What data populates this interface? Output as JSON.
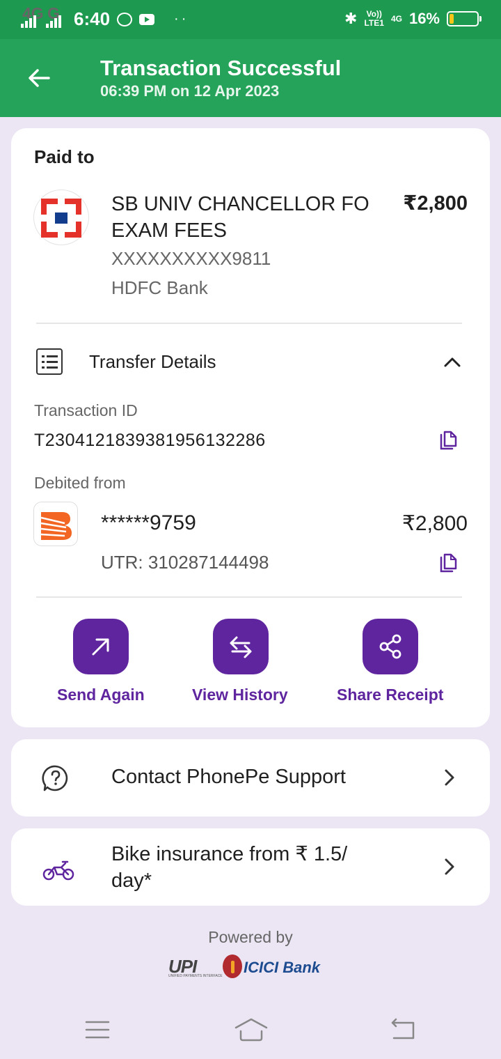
{
  "status_bar": {
    "net1": "4G",
    "net2": "G",
    "time": "6:40",
    "volte_line1": "Vo))",
    "volte_line2": "LTE1",
    "net3": "4G",
    "battery_text": "16%",
    "battery_level": 0.16,
    "icons": [
      "whatsapp-icon",
      "youtube-icon",
      "bluetooth-icon",
      "battery-icon"
    ]
  },
  "header": {
    "title": "Transaction Successful",
    "subtitle": "06:39 PM on 12 Apr 2023"
  },
  "paid_to": {
    "section_label": "Paid to",
    "name": "SB UNIV CHANCELLOR FO EXAM FEES",
    "amount": "₹2,800",
    "account": "XXXXXXXXXX9811",
    "bank": "HDFC Bank"
  },
  "transfer": {
    "title": "Transfer Details",
    "txn_id_label": "Transaction ID",
    "txn_id": "T2304121839381956132286",
    "debited_label": "Debited from",
    "debited_account": "******9759",
    "debited_amount": "₹2,800",
    "utr": "UTR: 310287144498"
  },
  "actions": {
    "send_again": "Send Again",
    "view_history": "View History",
    "share_receipt": "Share Receipt"
  },
  "support": {
    "label": "Contact PhonePe Support"
  },
  "promo": {
    "line1": "Bike insurance from ₹ 1.5/",
    "line2": "day*"
  },
  "footer": {
    "powered_by": "Powered by",
    "upi": "UPI",
    "upi_sub": "UNIFIED PAYMENTS INTERFACE",
    "icici": "ICICI Bank"
  },
  "colors": {
    "header_green": "#26a35a",
    "status_green": "#1e9a50",
    "accent_purple": "#5f259f",
    "page_bg": "#ece6f4"
  }
}
